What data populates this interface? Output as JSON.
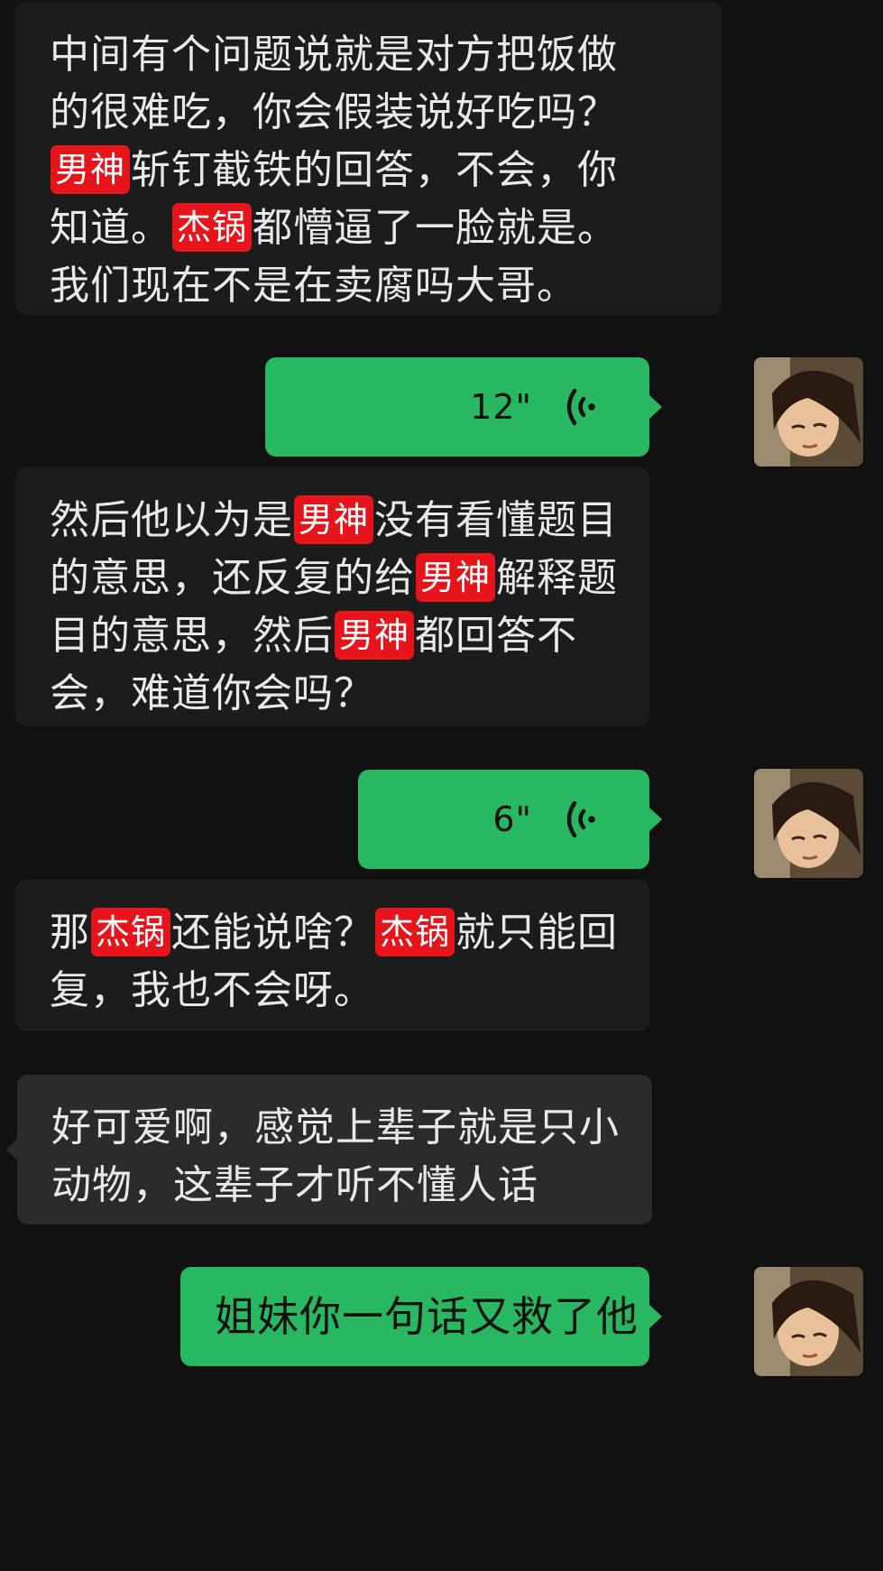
{
  "messages": {
    "m1": {
      "line1": "中间有个问题说就是对方把饭做",
      "line2": "的很难吃，你会假装说好吃吗？",
      "line3_tag": "男神",
      "line3_text": "斩钉截铁的回答，不会，你",
      "line4_pre": "知道。",
      "line4_tag": "杰锅",
      "line4_text": "都懵逼了一脸就是。",
      "line5": "我们现在不是在卖腐吗大哥。"
    },
    "m2": {
      "duration": "12\"",
      "icon": "voice-wave-icon"
    },
    "m3": {
      "line1_pre": "然后他以为是",
      "line1_tag": "男神",
      "line1_text": "没有看懂题目",
      "line2_pre": "的意思，还反复的给",
      "line2_tag": "男神",
      "line2_text": "解释题",
      "line3_pre": "目的意思，然后",
      "line3_tag": "男神",
      "line3_text": "都回答不",
      "line4": "会，难道你会吗？"
    },
    "m4": {
      "duration": "6\"",
      "icon": "voice-wave-icon"
    },
    "m5": {
      "line1_pre": "那",
      "line1_tag": "杰锅",
      "line1_mid": "还能说啥？",
      "line1_tag2": "杰锅",
      "line1_text": "就只能回",
      "line2": "复，我也不会呀。"
    },
    "m6": {
      "line1": "好可爱啊，感觉上辈子就是只小",
      "line2": "动物，这辈子才听不懂人话"
    },
    "m7": {
      "text": "姐妹你一句话又救了他"
    }
  },
  "colors": {
    "background": "#111111",
    "incoming_bubble": "#1c1c1c",
    "incoming_bubble_alt": "#2b2b2b",
    "outgoing_bubble": "#28b862",
    "tag": "#e8141c"
  }
}
